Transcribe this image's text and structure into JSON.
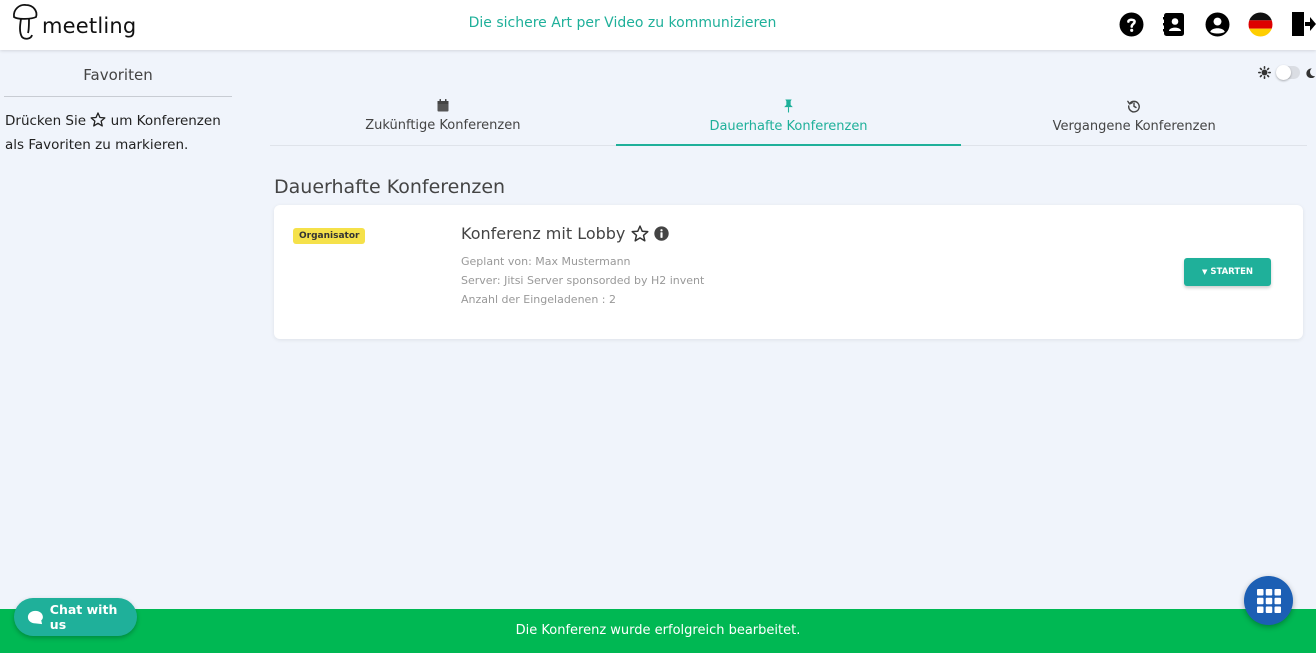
{
  "header": {
    "logo_text": "meetling",
    "slogan": "Die sichere Art per Video zu kommunizieren",
    "icons": [
      "help-icon",
      "contacts-icon",
      "account-icon",
      "flag-de-icon",
      "logout-icon"
    ]
  },
  "sidebar": {
    "title": "Favoriten",
    "hint_before": "Drücken Sie",
    "hint_line1_after": "um Konferenzen",
    "hint_line2": "als Favoriten zu markieren."
  },
  "tabs": [
    {
      "label": "Zukünftige Konferenzen",
      "icon": "calendar-icon",
      "active": false
    },
    {
      "label": "Dauerhafte Konferenzen",
      "icon": "pin-icon",
      "active": true
    },
    {
      "label": "Vergangene Konferenzen",
      "icon": "history-icon",
      "active": false
    }
  ],
  "section": {
    "title": "Dauerhafte Konferenzen"
  },
  "conference": {
    "badge": "Organisator",
    "title": "Konferenz mit Lobby",
    "planned_by": "Geplant von: Max Mustermann",
    "server": "Server: Jitsi Server sponsorded by H2 invent",
    "invitees": "Anzahl der Eingeladenen : 2",
    "start_label": "STARTEN"
  },
  "toast": {
    "message": "Die Konferenz wurde erfolgreich bearbeitet."
  },
  "chat": {
    "label": "Chat with us"
  },
  "colors": {
    "accent": "#1fb09a",
    "toast": "#00b853",
    "fab": "#1c5fb4",
    "badge": "#f5e14a",
    "background": "#f0f4fb"
  }
}
